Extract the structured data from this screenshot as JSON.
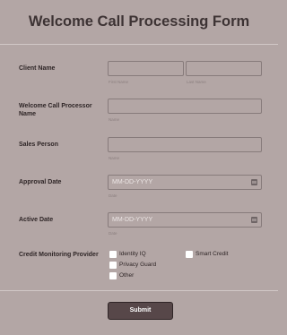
{
  "form": {
    "title": "Welcome Call Processing Form",
    "client_name": {
      "label": "Client Name",
      "first_sublabel": "First Name",
      "last_sublabel": "Last Name",
      "first_value": "",
      "last_value": ""
    },
    "processor_name": {
      "label": "Welcome Call Processor Name",
      "sublabel": "Name",
      "value": ""
    },
    "sales_person": {
      "label": "Sales Person",
      "sublabel": "Name",
      "value": ""
    },
    "approval_date": {
      "label": "Approval Date",
      "placeholder": "MM-DD-YYYY",
      "sublabel": "Date",
      "icon": "calendar-icon"
    },
    "active_date": {
      "label": "Active Date",
      "placeholder": "MM-DD-YYYY",
      "sublabel": "Date",
      "icon": "calendar-icon"
    },
    "credit_monitoring": {
      "label": "Credit Monitoring Provider",
      "options": [
        {
          "label": "Identity IQ",
          "checked": false
        },
        {
          "label": "Smart Credit",
          "checked": false
        },
        {
          "label": "Privacy Guard",
          "checked": false
        },
        {
          "label": "Other",
          "checked": false
        }
      ]
    },
    "submit_label": "Submit"
  },
  "colors": {
    "background": "#b3a6a5",
    "field_border": "#877b7b",
    "button": "#574749",
    "text": "#2e2526"
  }
}
